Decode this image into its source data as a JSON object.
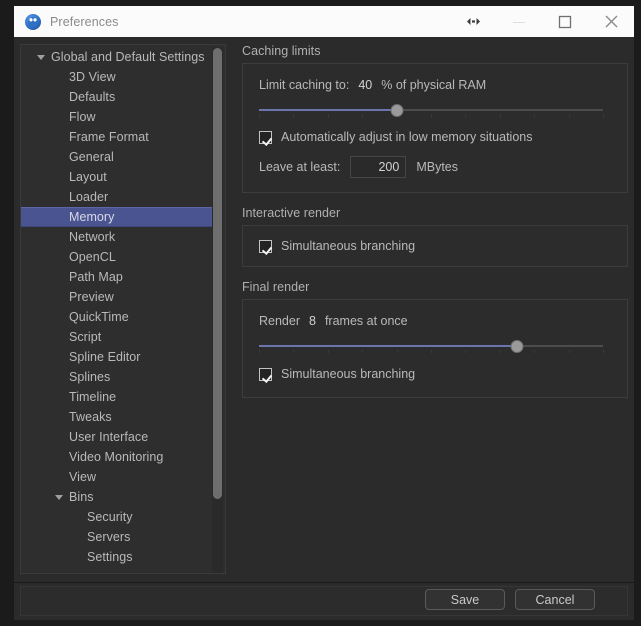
{
  "window": {
    "title": "Preferences",
    "app_icon": "preferences-app-icon",
    "controls": [
      {
        "name": "resize-arrows-icon",
        "label": "↔"
      },
      {
        "name": "minimize-button",
        "label": "—"
      },
      {
        "name": "maximize-button",
        "label": "☐"
      },
      {
        "name": "close-button",
        "label": "✕"
      }
    ]
  },
  "colors": {
    "window_frame": "#1b1b1b",
    "body_bg": "#2b2b2b",
    "panel_bg": "#2c2c2c",
    "titlebar_bg": "#fbfbfb",
    "selection": "#4a5490",
    "slider_fill": "#6a74ad",
    "slider_handle": "#9a9a9a",
    "text": "#b9b9b9"
  },
  "sidebar": {
    "scroll": {
      "thumb_top_pct": 0,
      "thumb_height_pct": 86
    },
    "items": [
      {
        "label": "Global and Default Settings",
        "level": 0,
        "expandable": true,
        "expanded": true,
        "selected": false
      },
      {
        "label": "3D View",
        "level": 1,
        "expandable": false,
        "selected": false
      },
      {
        "label": "Defaults",
        "level": 1,
        "expandable": false,
        "selected": false
      },
      {
        "label": "Flow",
        "level": 1,
        "expandable": false,
        "selected": false
      },
      {
        "label": "Frame Format",
        "level": 1,
        "expandable": false,
        "selected": false
      },
      {
        "label": "General",
        "level": 1,
        "expandable": false,
        "selected": false
      },
      {
        "label": "Layout",
        "level": 1,
        "expandable": false,
        "selected": false
      },
      {
        "label": "Loader",
        "level": 1,
        "expandable": false,
        "selected": false
      },
      {
        "label": "Memory",
        "level": 1,
        "expandable": false,
        "selected": true
      },
      {
        "label": "Network",
        "level": 1,
        "expandable": false,
        "selected": false
      },
      {
        "label": "OpenCL",
        "level": 1,
        "expandable": false,
        "selected": false
      },
      {
        "label": "Path Map",
        "level": 1,
        "expandable": false,
        "selected": false
      },
      {
        "label": "Preview",
        "level": 1,
        "expandable": false,
        "selected": false
      },
      {
        "label": "QuickTime",
        "level": 1,
        "expandable": false,
        "selected": false
      },
      {
        "label": "Script",
        "level": 1,
        "expandable": false,
        "selected": false
      },
      {
        "label": "Spline Editor",
        "level": 1,
        "expandable": false,
        "selected": false
      },
      {
        "label": "Splines",
        "level": 1,
        "expandable": false,
        "selected": false
      },
      {
        "label": "Timeline",
        "level": 1,
        "expandable": false,
        "selected": false
      },
      {
        "label": "Tweaks",
        "level": 1,
        "expandable": false,
        "selected": false
      },
      {
        "label": "User Interface",
        "level": 1,
        "expandable": false,
        "selected": false
      },
      {
        "label": "Video Monitoring",
        "level": 1,
        "expandable": false,
        "selected": false
      },
      {
        "label": "View",
        "level": 1,
        "expandable": false,
        "selected": false
      },
      {
        "label": "Bins",
        "level": 1,
        "expandable": true,
        "expanded": true,
        "selected": false
      },
      {
        "label": "Security",
        "level": 2,
        "expandable": false,
        "selected": false
      },
      {
        "label": "Servers",
        "level": 2,
        "expandable": false,
        "selected": false
      },
      {
        "label": "Settings",
        "level": 2,
        "expandable": false,
        "selected": false
      }
    ]
  },
  "panel": {
    "caching": {
      "title": "Caching limits",
      "limit_label": "Limit caching to:",
      "limit_value": "40",
      "limit_unit": "% of physical RAM",
      "limit_slider": {
        "value": 40,
        "min": 0,
        "max": 100,
        "fill_pct": 40,
        "ticks": 11
      },
      "auto_adjust": {
        "label": "Automatically adjust in low memory situations",
        "checked": true
      },
      "leave_label": "Leave at least:",
      "leave_value": "200",
      "leave_unit": "MBytes"
    },
    "interactive": {
      "title": "Interactive render",
      "simultaneous": {
        "label": "Simultaneous branching",
        "checked": true
      }
    },
    "final": {
      "title": "Final render",
      "render_label": "Render",
      "render_value": "8",
      "render_unit": "frames at once",
      "render_slider": {
        "value": 8,
        "min": 1,
        "max": 11,
        "fill_pct": 75,
        "ticks": 11
      },
      "simultaneous": {
        "label": "Simultaneous branching",
        "checked": true
      }
    }
  },
  "footer": {
    "save_label": "Save",
    "cancel_label": "Cancel"
  }
}
